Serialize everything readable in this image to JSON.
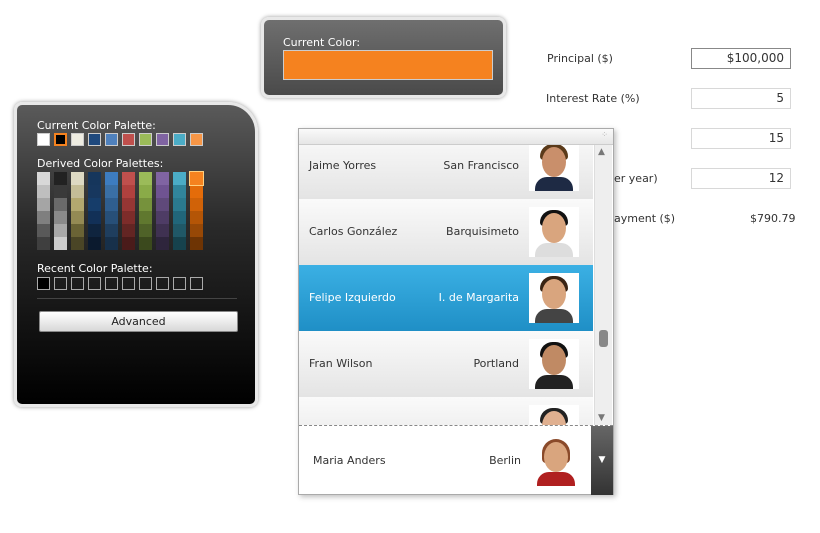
{
  "color_picker": {
    "current_color_label": "Current Color:",
    "current_color": "#f5821f",
    "current_palette_label": "Current Color Palette:",
    "current_palette": [
      "#ffffff",
      "#000000",
      "#eeece1",
      "#1f497d",
      "#4f81bd",
      "#c0504d",
      "#9bbb59",
      "#8064a2",
      "#4bacc6",
      "#f79646"
    ],
    "derived_palettes_label": "Derived Color Palettes:",
    "derived_palettes": [
      [
        "#d8d8d8",
        "#bfbfbf",
        "#a5a5a5",
        "#7f7f7f",
        "#595959",
        "#3f3f3f"
      ],
      [
        "#222222",
        "#3a3a3a",
        "#6a6a6a",
        "#8a8a8a",
        "#a8a8a8",
        "#cccccc"
      ],
      [
        "#ddd9c3",
        "#c4bd97",
        "#b3a86f",
        "#948a54",
        "#6a6335",
        "#4a4526"
      ],
      [
        "#16365c",
        "#17375e",
        "#163d6a",
        "#123057",
        "#0f243e",
        "#0b1a2e"
      ],
      [
        "#3d7cc0",
        "#3a6fa5",
        "#2f5e8f",
        "#274f78",
        "#1f3e5e",
        "#17304a"
      ],
      [
        "#c0504d",
        "#b0413e",
        "#963634",
        "#7d2c2a",
        "#632523",
        "#4a1b1a"
      ],
      [
        "#9bbb59",
        "#8aab48",
        "#76923c",
        "#60782f",
        "#4f6228",
        "#3b491d"
      ],
      [
        "#8064a2",
        "#6f5391",
        "#5f497a",
        "#4e3c65",
        "#3f3151",
        "#2e253c"
      ],
      [
        "#4bacc6",
        "#31859c",
        "#2b7a8f",
        "#21667a",
        "#205867",
        "#16424d"
      ],
      [
        "#f5821f",
        "#e46c0a",
        "#d06208",
        "#b45506",
        "#974806",
        "#6e3404"
      ]
    ],
    "selected_derived": "#f5821f",
    "recent_palette_label": "Recent Color Palette:",
    "recent_palette": [
      "#000000",
      "",
      "",
      "",
      "",
      "",
      "",
      "",
      "",
      ""
    ],
    "advanced_label": "Advanced"
  },
  "form": {
    "principal_label": "Principal ($)",
    "principal_value": "$100,000",
    "rate_label": "Interest Rate (%)",
    "rate_value": "5",
    "term_value": "15",
    "payments_label_visible": "er year)",
    "payments_value": "12",
    "payment_label_visible": "ayment ($)",
    "payment_value": "$790.79"
  },
  "list": {
    "items": [
      {
        "name": "Jaime Yorres",
        "city": "San Francisco"
      },
      {
        "name": "Carlos González",
        "city": "Barquisimeto"
      },
      {
        "name": "Felipe Izquierdo",
        "city": "I. de Margarita",
        "selected": true
      },
      {
        "name": "Fran Wilson",
        "city": "Portland"
      },
      {
        "name": "",
        "city": ""
      }
    ],
    "selected_accent": "#2ea3d9",
    "combo": {
      "name": "Maria Anders",
      "city": "Berlin"
    }
  }
}
